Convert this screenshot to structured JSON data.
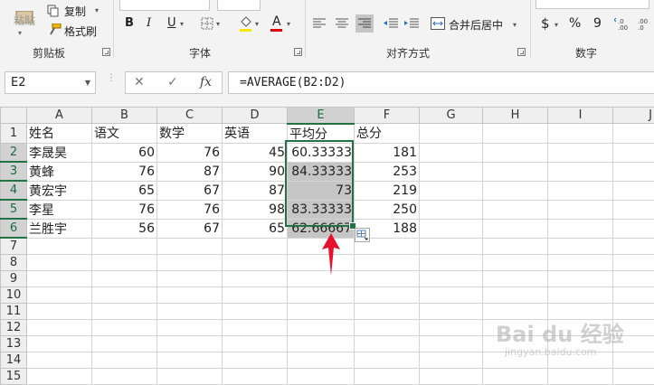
{
  "ribbon": {
    "clipboard": {
      "paste_label": "粘贴",
      "copy_label": "复制",
      "format_painter_label": "格式刷",
      "group_label": "剪贴板"
    },
    "font": {
      "group_label": "字体",
      "bold_label": "B",
      "italic_label": "I",
      "underline_label": "U",
      "font_color_label": "A",
      "highlight_color": "#ffe600",
      "font_color": "#e00000"
    },
    "alignment": {
      "merge_center_label": "合并后居中",
      "group_label": "对齐方式"
    },
    "number": {
      "currency_label": "$",
      "percent_label": "%",
      "comma_label": "9",
      "group_label": "数字"
    }
  },
  "formula_bar": {
    "name_box": "E2",
    "cancel_label": "✕",
    "enter_label": "✓",
    "fx_label": "fx",
    "formula": "=AVERAGE(B2:D2)"
  },
  "grid": {
    "columns": [
      "A",
      "B",
      "C",
      "D",
      "E",
      "F",
      "G",
      "H",
      "I",
      "J"
    ],
    "row_numbers": [
      "1",
      "2",
      "3",
      "4",
      "5",
      "6",
      "7",
      "8",
      "9",
      "10",
      "11",
      "12",
      "13",
      "14",
      "15"
    ],
    "headers": [
      "姓名",
      "语文",
      "数学",
      "英语",
      "平均分",
      "总分"
    ],
    "rows": [
      [
        "李晟昊",
        "60",
        "76",
        "45",
        "60.33333",
        "181"
      ],
      [
        "黄蜂",
        "76",
        "87",
        "90",
        "84.33333",
        "253"
      ],
      [
        "黄宏宇",
        "65",
        "67",
        "87",
        "73",
        "219"
      ],
      [
        "李星",
        "76",
        "76",
        "98",
        "83.33333",
        "250"
      ],
      [
        "兰胜宇",
        "56",
        "67",
        "65",
        "62.66667",
        "188"
      ]
    ]
  },
  "colors": {
    "selection_border": "#217346",
    "selection_fill": "#c6c6c6",
    "arrow": "#e8112d"
  },
  "watermark": {
    "brand": "Bai  du 经验",
    "url": "jingyan.baidu.com"
  }
}
